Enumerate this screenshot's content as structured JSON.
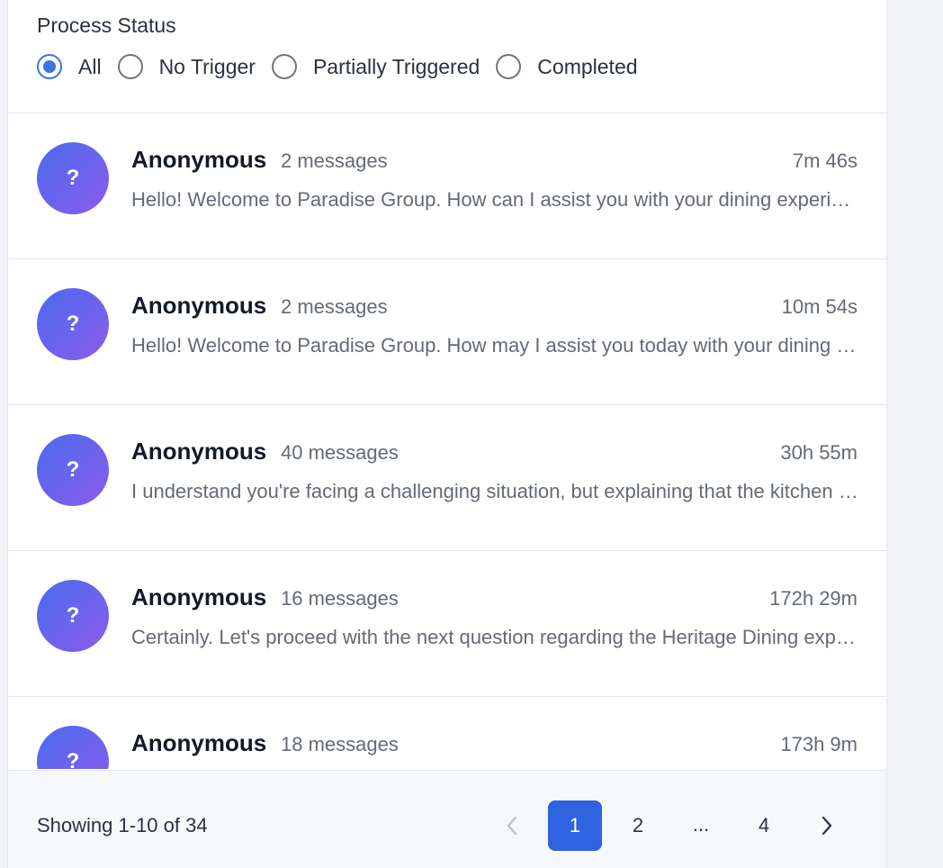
{
  "filter": {
    "title": "Process Status",
    "options": [
      {
        "label": "All",
        "checked": true
      },
      {
        "label": "No Trigger",
        "checked": false
      },
      {
        "label": "Partially Triggered",
        "checked": false
      },
      {
        "label": "Completed",
        "checked": false
      }
    ]
  },
  "conversations": [
    {
      "avatar": "?",
      "name": "Anonymous",
      "messages": "2 messages",
      "duration": "7m 46s",
      "preview": "Hello! Welcome to Paradise Group. How can I assist you with your dining experience today?"
    },
    {
      "avatar": "?",
      "name": "Anonymous",
      "messages": "2 messages",
      "duration": "10m 54s",
      "preview": "Hello! Welcome to Paradise Group. How may I assist you today with your dining experience?"
    },
    {
      "avatar": "?",
      "name": "Anonymous",
      "messages": "40 messages",
      "duration": "30h 55m",
      "preview": "I understand you're facing a challenging situation, but explaining that the kitchen has closed"
    },
    {
      "avatar": "?",
      "name": "Anonymous",
      "messages": "16 messages",
      "duration": "172h 29m",
      "preview": "Certainly. Let's proceed with the next question regarding the Heritage Dining experience."
    },
    {
      "avatar": "?",
      "name": "Anonymous",
      "messages": "18 messages",
      "duration": "173h 9m",
      "preview": ""
    }
  ],
  "pagination": {
    "showing": "Showing 1-10 of 34",
    "pages": [
      "1",
      "2",
      "...",
      "4"
    ],
    "current": "1",
    "prev_icon": "chevron-left-icon",
    "next_icon": "chevron-right-icon"
  },
  "colors": {
    "accent": "#2f63e0",
    "radio_selected": "#3a75e6",
    "avatar_gradient_start": "#4a6cf0",
    "avatar_gradient_end": "#8b5be8"
  }
}
